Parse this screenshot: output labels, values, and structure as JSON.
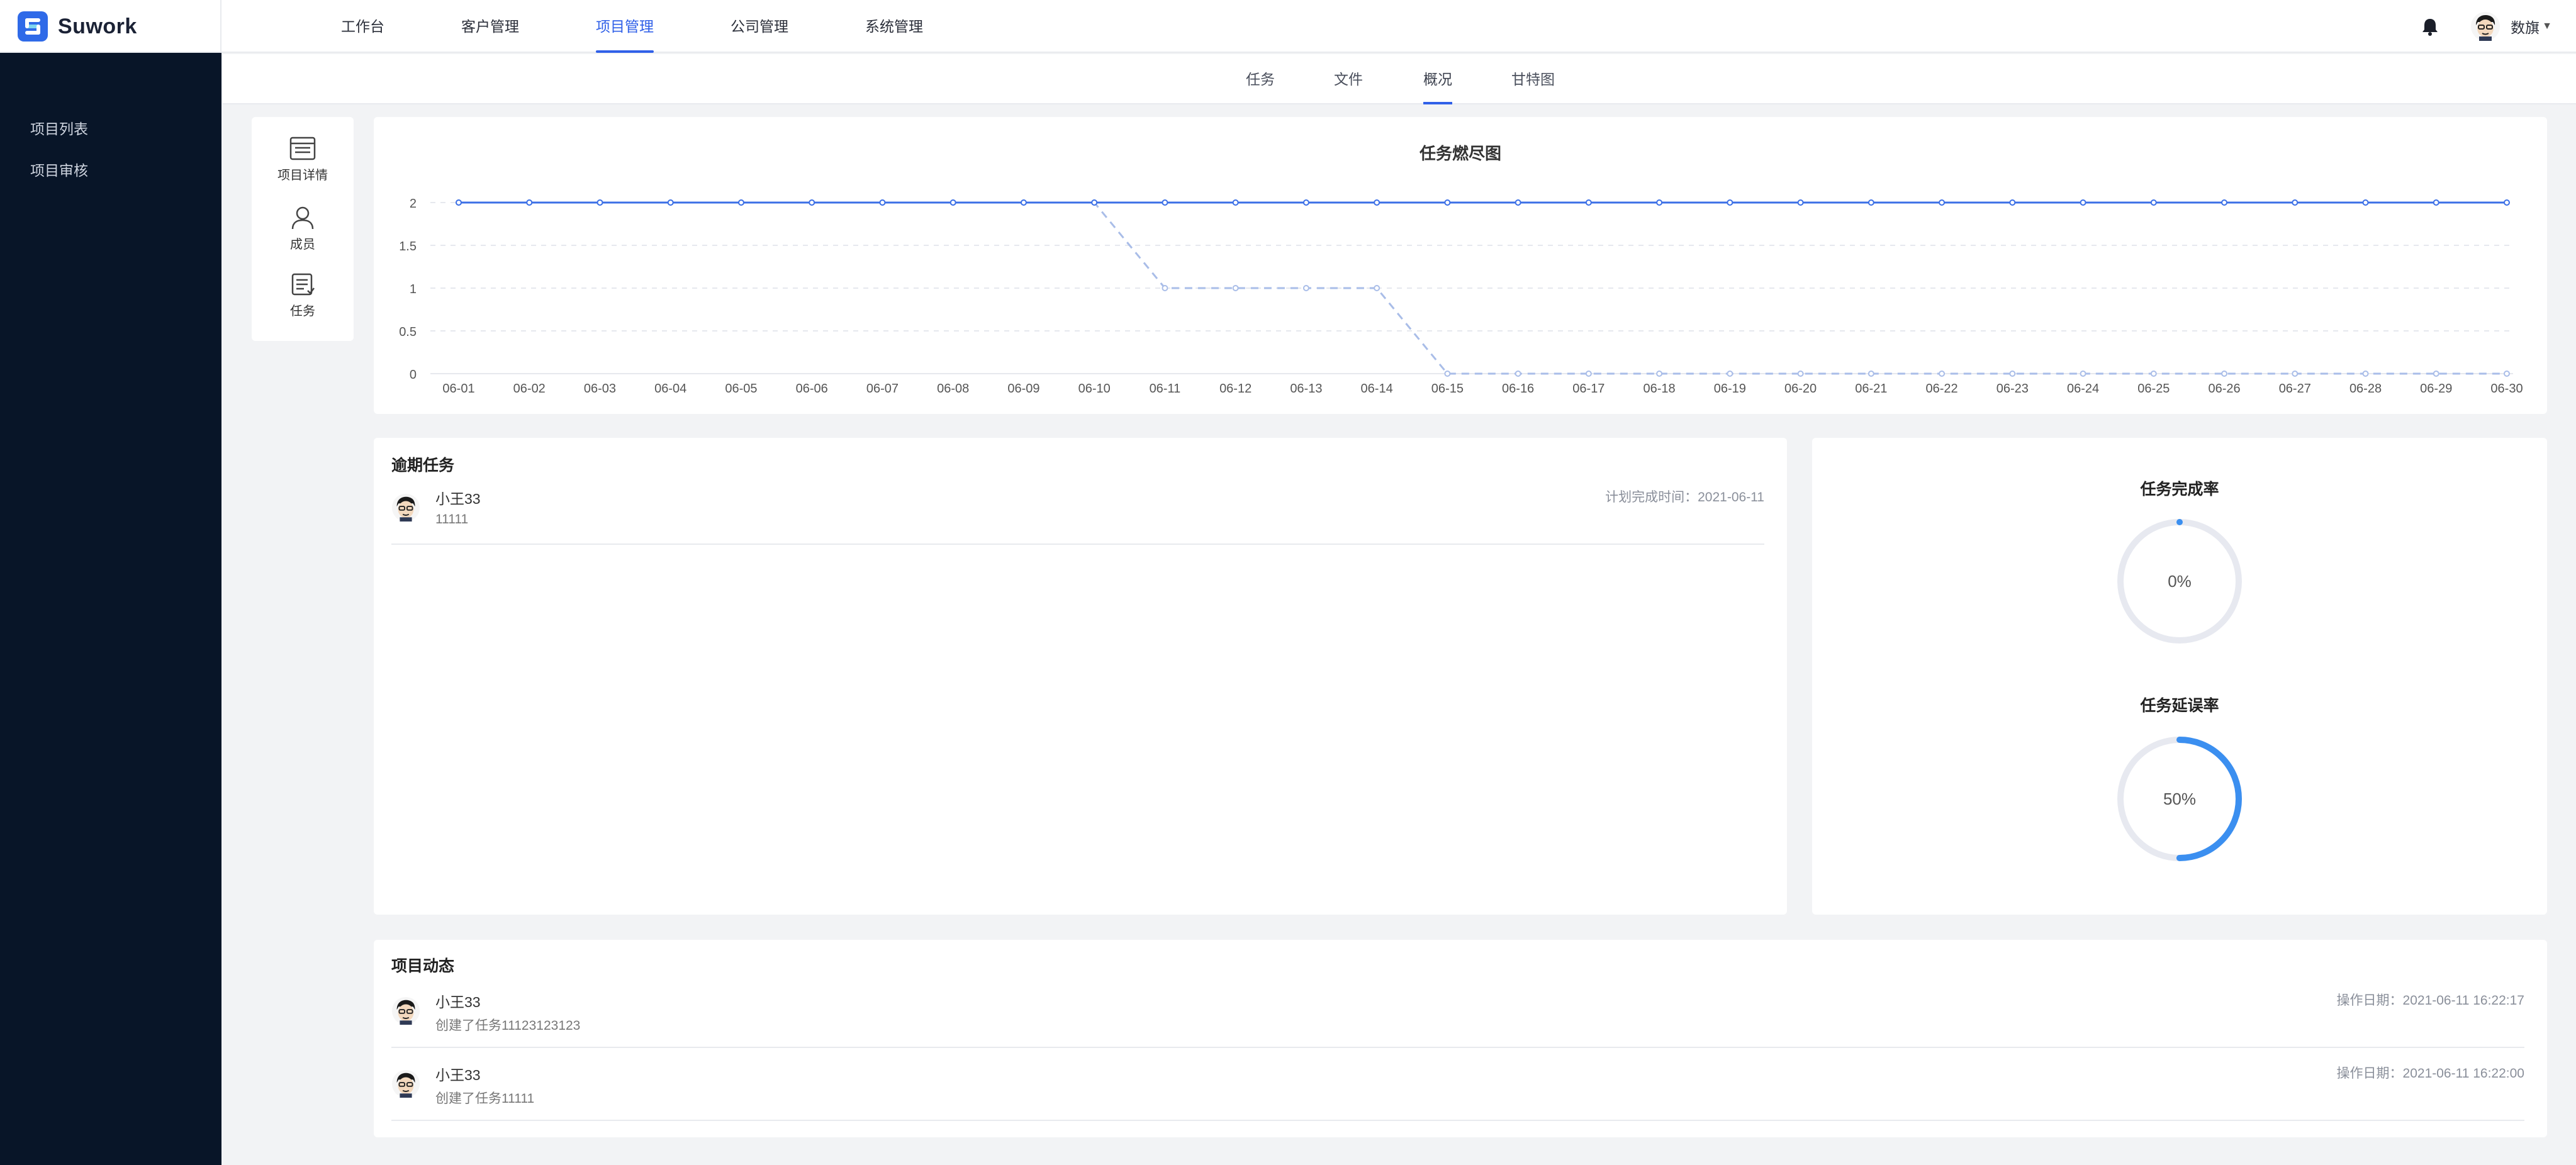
{
  "app": {
    "name": "Suwork"
  },
  "topnav": [
    "工作台",
    "客户管理",
    "项目管理",
    "公司管理",
    "系统管理"
  ],
  "user": {
    "name": "数旗"
  },
  "sidebar": {
    "items": [
      "项目列表",
      "项目审核"
    ]
  },
  "subnav": [
    "任务",
    "文件",
    "概况",
    "甘特图"
  ],
  "side_actions": [
    "项目详情",
    "成员",
    "任务"
  ],
  "chart_data": {
    "type": "line",
    "title": "任务燃尽图",
    "x": [
      "06-01",
      "06-02",
      "06-03",
      "06-04",
      "06-05",
      "06-06",
      "06-07",
      "06-08",
      "06-09",
      "06-10",
      "06-11",
      "06-12",
      "06-13",
      "06-14",
      "06-15",
      "06-16",
      "06-17",
      "06-18",
      "06-19",
      "06-20",
      "06-21",
      "06-22",
      "06-23",
      "06-24",
      "06-25",
      "06-26",
      "06-27",
      "06-28",
      "06-29",
      "06-30"
    ],
    "y_ticks": [
      "0",
      "0.5",
      "1",
      "1.5",
      "2"
    ],
    "ylim": [
      0,
      2
    ],
    "grid": true,
    "series": [
      {
        "style": "solid",
        "color": "#3b6fe6",
        "values": [
          2,
          2,
          2,
          2,
          2,
          2,
          2,
          2,
          2,
          2,
          2,
          2,
          2,
          2,
          2,
          2,
          2,
          2,
          2,
          2,
          2,
          2,
          2,
          2,
          2,
          2,
          2,
          2,
          2,
          2
        ]
      },
      {
        "style": "dashed",
        "color": "#a9bde8",
        "values": [
          2,
          2,
          2,
          2,
          2,
          2,
          2,
          2,
          2,
          2,
          1,
          1,
          1,
          1,
          0,
          0,
          0,
          0,
          0,
          0,
          0,
          0,
          0,
          0,
          0,
          0,
          0,
          0,
          0,
          0
        ]
      }
    ]
  },
  "overdue": {
    "title": "逾期任务",
    "items": [
      {
        "name": "小王33",
        "desc": "11111",
        "time": "计划完成时间：2021-06-11"
      }
    ]
  },
  "rates": {
    "completion": {
      "title": "任务完成率",
      "label": "0%",
      "value": 0
    },
    "delay": {
      "title": "任务延误率",
      "label": "50%",
      "value": 50
    },
    "accent": "#3b8ff0",
    "track": "#e7e9f0"
  },
  "activity": {
    "title": "项目动态",
    "items": [
      {
        "name": "小王33",
        "desc": "创建了任务11123123123",
        "time": "操作日期：2021-06-11 16:22:17"
      },
      {
        "name": "小王33",
        "desc": "创建了任务11111",
        "time": "操作日期：2021-06-11 16:22:00"
      }
    ]
  }
}
